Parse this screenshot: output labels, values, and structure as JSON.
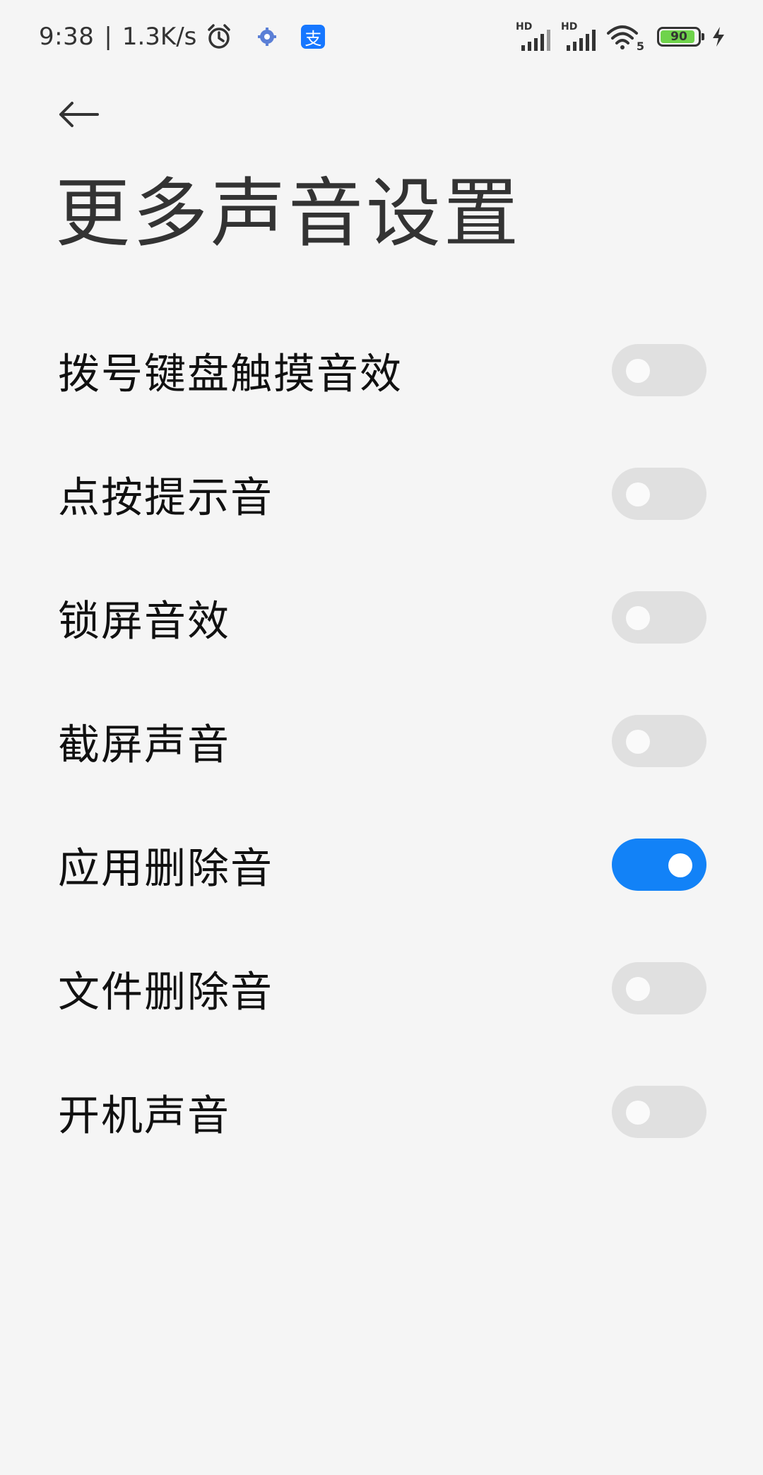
{
  "status_bar": {
    "time": "9:38",
    "separator": "|",
    "network_speed": "1.3K/s",
    "alipay_glyph": "支",
    "sim1_label": "HD",
    "sim2_label": "HD",
    "wifi_label": "5",
    "battery_level": "90",
    "battery_color": "#6fd34b",
    "icons": [
      "alarm-clock-icon",
      "settings-gear-icon",
      "alipay-icon",
      "signal-icon",
      "signal-icon",
      "wifi-icon",
      "battery-icon",
      "charging-bolt-icon"
    ]
  },
  "header": {
    "back_icon": "arrow-left-icon",
    "title": "更多声音设置"
  },
  "settings": [
    {
      "label": "拨号键盘触摸音效",
      "enabled": false
    },
    {
      "label": "点按提示音",
      "enabled": false
    },
    {
      "label": "锁屏音效",
      "enabled": false
    },
    {
      "label": "截屏声音",
      "enabled": false
    },
    {
      "label": "应用删除音",
      "enabled": true
    },
    {
      "label": "文件删除音",
      "enabled": false
    },
    {
      "label": "开机声音",
      "enabled": false
    }
  ],
  "colors": {
    "background": "#f5f5f5",
    "toggle_on": "#1282f7",
    "toggle_off": "#e0e0e0"
  }
}
